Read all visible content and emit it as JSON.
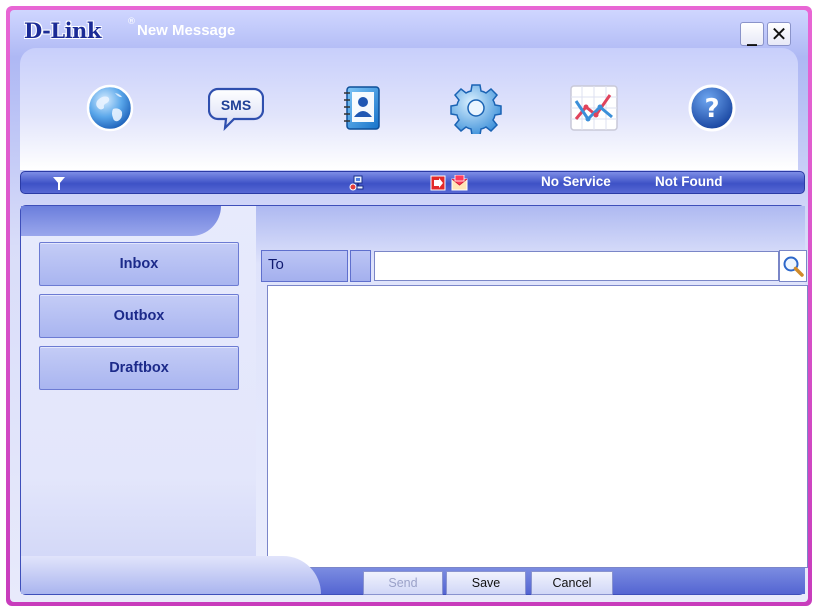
{
  "titlebar": {
    "brand": "D-Link",
    "brand_mark": "®",
    "title": "New Message",
    "minimize_label": "_",
    "close_label": "✕"
  },
  "toolbar": {
    "icons": [
      "globe-icon",
      "sms-icon",
      "contacts-icon",
      "gear-icon",
      "statistics-chart-icon",
      "help-icon"
    ],
    "sms_label": "SMS",
    "help_label": "?"
  },
  "status": {
    "icons": [
      "signal-antenna-icon",
      "network-icon",
      "sim-icon",
      "mail-icon"
    ],
    "service": "No Service",
    "device": "Not Found"
  },
  "sidebar": {
    "items": [
      {
        "label": "Inbox"
      },
      {
        "label": "Outbox"
      },
      {
        "label": "Draftbox"
      }
    ]
  },
  "compose": {
    "to_label": "To",
    "to_value": "",
    "body_value": ""
  },
  "actions": {
    "send": "Send",
    "save": "Save",
    "cancel": "Cancel"
  },
  "colors": {
    "frame": "#d850c8",
    "title_text": "#ffffff",
    "brand": "#1b2b96",
    "status_bar": "#4a5cc9",
    "sidebar_button": "#b2bdf2",
    "send_disabled": "#9ba2c9"
  }
}
